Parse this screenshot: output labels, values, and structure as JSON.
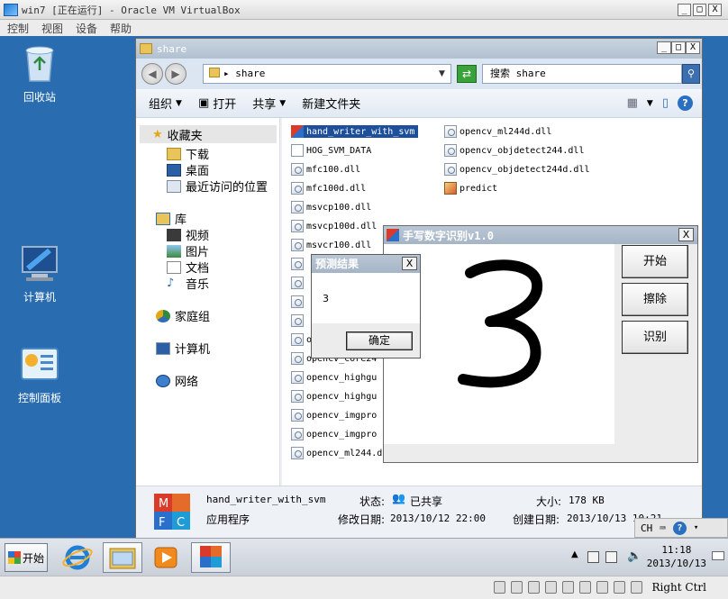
{
  "vbox": {
    "title": "win7 [正在运行] - Oracle VM VirtualBox",
    "menu": [
      "控制",
      "视图",
      "设备",
      "帮助"
    ],
    "host_key": "Right Ctrl"
  },
  "desktop": {
    "icons": [
      {
        "label": "回收站",
        "icon": "recycle-bin-icon"
      },
      {
        "label": "计算机",
        "icon": "computer-icon"
      },
      {
        "label": "控制面板",
        "icon": "control-panel-icon"
      }
    ]
  },
  "explorer": {
    "title": "share",
    "address": "share",
    "search_placeholder": "搜索 share",
    "toolbar": {
      "organize": "组织",
      "open": "打开",
      "share": "共享",
      "new_folder": "新建文件夹"
    },
    "nav": {
      "favorites": "收藏夹",
      "downloads": "下载",
      "desktop": "桌面",
      "recent": "最近访问的位置",
      "libraries": "库",
      "videos": "视频",
      "pictures": "图片",
      "documents": "文档",
      "music": "音乐",
      "homegroup": "家庭组",
      "computer": "计算机",
      "network": "网络"
    },
    "files_col1": [
      {
        "name": "hand_writer_with_svm",
        "type": "exe",
        "selected": true
      },
      {
        "name": "HOG_SVM_DATA",
        "type": "doc"
      },
      {
        "name": "mfc100.dll",
        "type": "dll"
      },
      {
        "name": "mfc100d.dll",
        "type": "dll"
      },
      {
        "name": "msvcp100.dll",
        "type": "dll"
      },
      {
        "name": "msvcp100d.dll",
        "type": "dll"
      },
      {
        "name": "msvcr100.dll",
        "type": "dll"
      },
      {
        "name": "",
        "type": "dll"
      },
      {
        "name": "",
        "type": "dll"
      },
      {
        "name": "",
        "type": "dll"
      },
      {
        "name": "",
        "type": "dll"
      },
      {
        "name": "opencv_core2",
        "type": "dll"
      },
      {
        "name": "opencv_core24",
        "type": "dll"
      },
      {
        "name": "opencv_highgu",
        "type": "dll"
      },
      {
        "name": "opencv_highgu",
        "type": "dll"
      },
      {
        "name": "opencv_imgpro",
        "type": "dll"
      },
      {
        "name": "opencv_imgpro",
        "type": "dll"
      },
      {
        "name": "opencv_ml244.dll",
        "type": "dll"
      }
    ],
    "files_col2": [
      {
        "name": "opencv_ml244d.dll",
        "type": "dll"
      },
      {
        "name": "opencv_objdetect244.dll",
        "type": "dll"
      },
      {
        "name": "opencv_objdetect244d.dll",
        "type": "dll"
      },
      {
        "name": "predict",
        "type": "img"
      }
    ],
    "details": {
      "name": "hand_writer_with_svm",
      "type": "应用程序",
      "status_label": "状态:",
      "status_value": "已共享",
      "size_label": "大小:",
      "size_value": "178 KB",
      "modified_label": "修改日期:",
      "modified_value": "2013/10/12 22:00",
      "created_label": "创建日期:",
      "created_value": "2013/10/13 10:21"
    }
  },
  "hw_app": {
    "title_cn": "手写数字识别",
    "title_ver": "v1.0",
    "buttons": {
      "start": "开始",
      "erase": "擦除",
      "recognize": "识别"
    },
    "drawn_digit": "3"
  },
  "result_dialog": {
    "title": "预测结果",
    "value": "3",
    "ok": "确定"
  },
  "taskbar": {
    "start": "开始",
    "time": "11:18",
    "date": "2013/10/13",
    "lang": "CH"
  }
}
